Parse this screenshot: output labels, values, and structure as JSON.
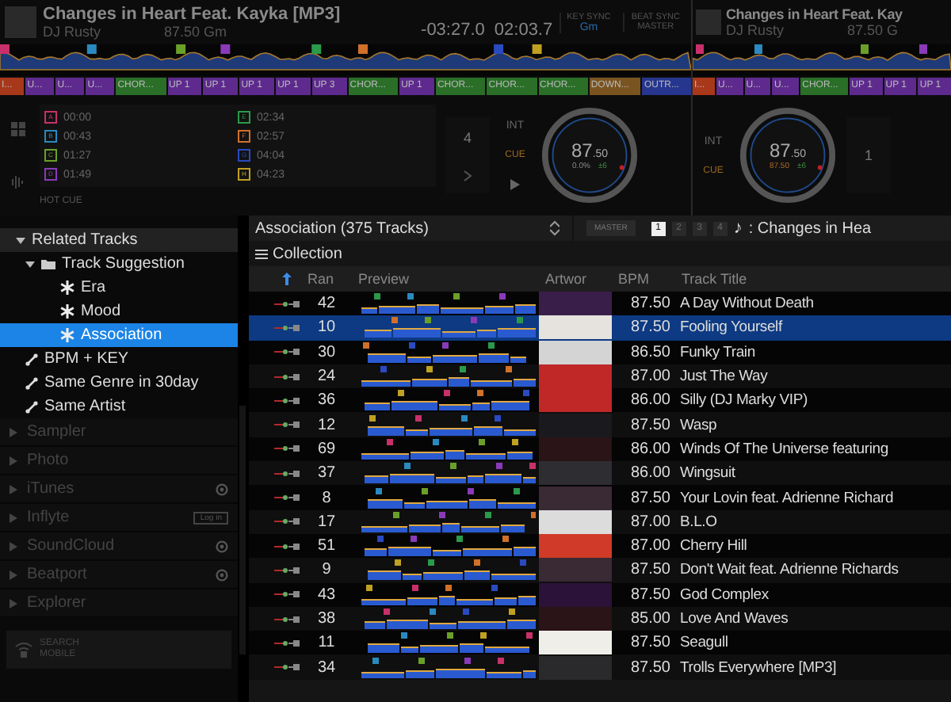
{
  "decks": [
    {
      "title": "Changes in Heart Feat. Kayka [MP3]",
      "artist": "DJ Rusty",
      "bpm_key": "87.50 Gm",
      "remain": "-03:27.0",
      "elapsed": "02:03.7",
      "key_sync": "KEY SYNC",
      "key": "Gm",
      "beat_sync": "BEAT SYNC",
      "master": "MASTER",
      "int_label": "INT",
      "cue_label": "CUE",
      "jog_whole": "87",
      "jog_fraction": ".50",
      "pitch": "0.0%",
      "range": "±6",
      "beat_jump": "4",
      "hot_cue_label": "HOT CUE",
      "phrases": [
        {
          "label": "I...",
          "color": "#a8381a"
        },
        {
          "label": "U...",
          "color": "#5e2a8e"
        },
        {
          "label": "U...",
          "color": "#5e2a8e"
        },
        {
          "label": "U...",
          "color": "#5e2a8e"
        },
        {
          "label": "CHOR...",
          "color": "#2a6e28"
        },
        {
          "label": "UP 1",
          "color": "#5e2a8e"
        },
        {
          "label": "UP 1",
          "color": "#5e2a8e"
        },
        {
          "label": "UP 1",
          "color": "#5e2a8e"
        },
        {
          "label": "UP 1",
          "color": "#5e2a8e"
        },
        {
          "label": "UP 3",
          "color": "#5e2a8e"
        },
        {
          "label": "CHOR...",
          "color": "#2a6e28"
        },
        {
          "label": "UP 1",
          "color": "#5e2a8e"
        },
        {
          "label": "CHOR...",
          "color": "#2a6e28"
        },
        {
          "label": "CHOR...",
          "color": "#2a6e28"
        },
        {
          "label": "CHOR...",
          "color": "#2a6e28"
        },
        {
          "label": "DOWN...",
          "color": "#7a5420"
        },
        {
          "label": "OUTR...",
          "color": "#26368e"
        }
      ],
      "hot_cues": [
        {
          "letter": "A",
          "time": "00:00",
          "color": "#c8306a"
        },
        {
          "letter": "B",
          "time": "00:43",
          "color": "#2a8ac0"
        },
        {
          "letter": "C",
          "time": "01:27",
          "color": "#6aa028"
        },
        {
          "letter": "D",
          "time": "01:49",
          "color": "#8a3ab8"
        },
        {
          "letter": "E",
          "time": "02:34",
          "color": "#2a9a4a"
        },
        {
          "letter": "F",
          "time": "02:57",
          "color": "#d0702a"
        },
        {
          "letter": "G",
          "time": "04:04",
          "color": "#2a4ac0"
        },
        {
          "letter": "H",
          "time": "04:23",
          "color": "#c0a020"
        }
      ]
    },
    {
      "title": "Changes in Heart Feat. Kay",
      "artist": "DJ Rusty",
      "bpm_key": "87.50 G",
      "int_label": "INT",
      "cue_label": "CUE",
      "jog_whole": "87",
      "jog_fraction": ".50",
      "pitch": "87.50",
      "range": "±6",
      "beat_jump": "1",
      "phrases": [
        {
          "label": "I...",
          "color": "#a8381a"
        },
        {
          "label": "U...",
          "color": "#5e2a8e"
        },
        {
          "label": "U...",
          "color": "#5e2a8e"
        },
        {
          "label": "U...",
          "color": "#5e2a8e"
        },
        {
          "label": "CHOR...",
          "color": "#2a6e28"
        },
        {
          "label": "UP 1",
          "color": "#5e2a8e"
        },
        {
          "label": "UP 1",
          "color": "#5e2a8e"
        },
        {
          "label": "UP 1",
          "color": "#5e2a8e"
        }
      ],
      "cue_markers": [
        {
          "color": "#c8306a"
        },
        {
          "color": "#2a8ac0"
        },
        {
          "color": "#6aa028"
        },
        {
          "color": "#8a3ab8"
        }
      ]
    }
  ],
  "sidebar": {
    "tree": [
      {
        "label": "Related Tracks",
        "expanded": true,
        "selected": false,
        "children": [
          {
            "label": "Track Suggestion",
            "kind": "folder",
            "expanded": true,
            "selected": false,
            "children": [
              {
                "label": "Era",
                "kind": "suggest",
                "selected": false
              },
              {
                "label": "Mood",
                "kind": "suggest",
                "selected": false
              },
              {
                "label": "Association",
                "kind": "suggest",
                "selected": true
              }
            ]
          },
          {
            "label": "BPM + KEY",
            "kind": "filter",
            "selected": false
          },
          {
            "label": "Same Genre in 30day",
            "kind": "filter",
            "selected": false
          },
          {
            "label": "Same Artist",
            "kind": "filter",
            "selected": false
          }
        ]
      }
    ],
    "sources": [
      {
        "label": "Sampler",
        "kind": "plain"
      },
      {
        "label": "Photo",
        "kind": "plain"
      },
      {
        "label": "iTunes",
        "kind": "linked"
      },
      {
        "label": "Inflyte",
        "kind": "login",
        "badge": "Log in"
      },
      {
        "label": "SoundCloud",
        "kind": "linked"
      },
      {
        "label": "Beatport",
        "kind": "linked"
      },
      {
        "label": "Explorer",
        "kind": "plain"
      }
    ],
    "search_mobile": "SEARCH MOBILE"
  },
  "browser": {
    "title": "Association (375 Tracks)",
    "master": "MASTER",
    "decks": [
      {
        "label": "1",
        "selected": true
      },
      {
        "label": "2",
        "selected": false
      },
      {
        "label": "3",
        "selected": false
      },
      {
        "label": "4",
        "selected": false
      }
    ],
    "note": "♪",
    "now_playing": ": Changes in Hea",
    "collection": "Collection",
    "columns": [
      "Ran",
      "Preview",
      "Artwor",
      "BPM",
      "Track Title"
    ],
    "rows": [
      {
        "rank": "42",
        "bpm": "87.50",
        "title": "A Day Without Death",
        "selected": false
      },
      {
        "rank": "10",
        "bpm": "87.50",
        "title": "Fooling Yourself",
        "selected": true
      },
      {
        "rank": "30",
        "bpm": "86.50",
        "title": "Funky Train",
        "selected": false
      },
      {
        "rank": "24",
        "bpm": "87.00",
        "title": "Just The Way",
        "selected": false
      },
      {
        "rank": "36",
        "bpm": "86.00",
        "title": "Silly (DJ Marky VIP)",
        "selected": false
      },
      {
        "rank": "12",
        "bpm": "87.50",
        "title": "Wasp",
        "selected": false
      },
      {
        "rank": "69",
        "bpm": "86.00",
        "title": "Winds Of The Universe featuring",
        "selected": false
      },
      {
        "rank": "37",
        "bpm": "86.00",
        "title": "Wingsuit",
        "selected": false
      },
      {
        "rank": "8",
        "bpm": "87.50",
        "title": "Your Lovin feat. Adrienne Richard",
        "selected": false
      },
      {
        "rank": "17",
        "bpm": "87.00",
        "title": "B.L.O",
        "selected": false
      },
      {
        "rank": "51",
        "bpm": "87.00",
        "title": "Cherry Hill",
        "selected": false
      },
      {
        "rank": "9",
        "bpm": "87.50",
        "title": "Don't Wait feat. Adrienne Richards",
        "selected": false
      },
      {
        "rank": "43",
        "bpm": "87.50",
        "title": "God Complex",
        "selected": false
      },
      {
        "rank": "38",
        "bpm": "85.00",
        "title": "Love And Waves",
        "selected": false
      },
      {
        "rank": "11",
        "bpm": "87.50",
        "title": "Seagull",
        "selected": false
      },
      {
        "rank": "34",
        "bpm": "87.50",
        "title": "Trolls Everywhere [MP3]",
        "selected": false
      }
    ]
  }
}
